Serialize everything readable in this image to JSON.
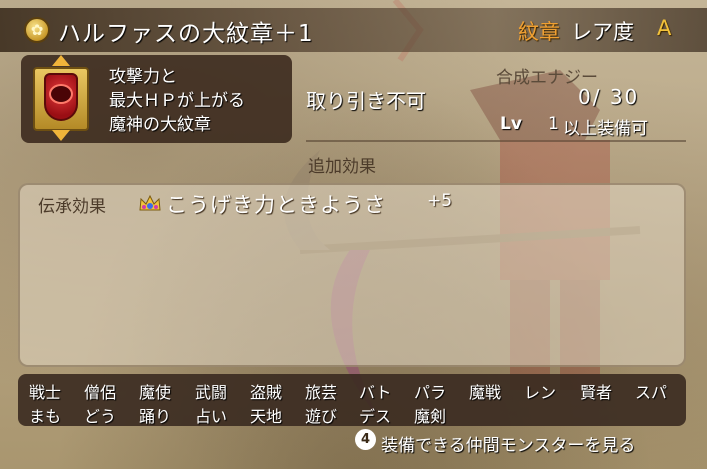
{
  "header": {
    "title": "ハルファスの大紋章＋1",
    "rarity_key": "紋章",
    "rarity_label": "レア度",
    "rarity_value": "A"
  },
  "description": {
    "lines": [
      "攻撃力と",
      "最大ＨＰが上がる",
      "魔神の大紋章"
    ]
  },
  "status": {
    "trade": "取り引き不可",
    "energy_label": "合成エナジー",
    "energy_value": "0/ 30",
    "lv_label": "Lv",
    "lv_value": "1",
    "lv_requirement": "以上装備可"
  },
  "bonus": {
    "header": "追加効果",
    "inherit_label": "伝承効果",
    "effect_text": "こうげき力ときようさ",
    "effect_value": "+5"
  },
  "jobs": {
    "row1": [
      "戦士",
      "僧侶",
      "魔使",
      "武闘",
      "盗賊",
      "旅芸",
      "バト",
      "パラ",
      "魔戦",
      "レン",
      "賢者",
      "スパ"
    ],
    "row2": [
      "まも",
      "どう",
      "踊り",
      "占い",
      "天地",
      "遊び",
      "デス",
      "魔剣"
    ]
  },
  "footer": {
    "button_number": "4",
    "button_label": "装備できる仲間モンスターを見る"
  },
  "icons": {
    "title": "emblem-coin-icon",
    "emblem": "demon-emblem-icon",
    "inherit": "crown-icon",
    "footer": "button-4-icon"
  },
  "colors": {
    "accent_orange": "#f0a032",
    "rarity_gold": "#f3c23a",
    "panel_dark": "#3c2a1e"
  }
}
